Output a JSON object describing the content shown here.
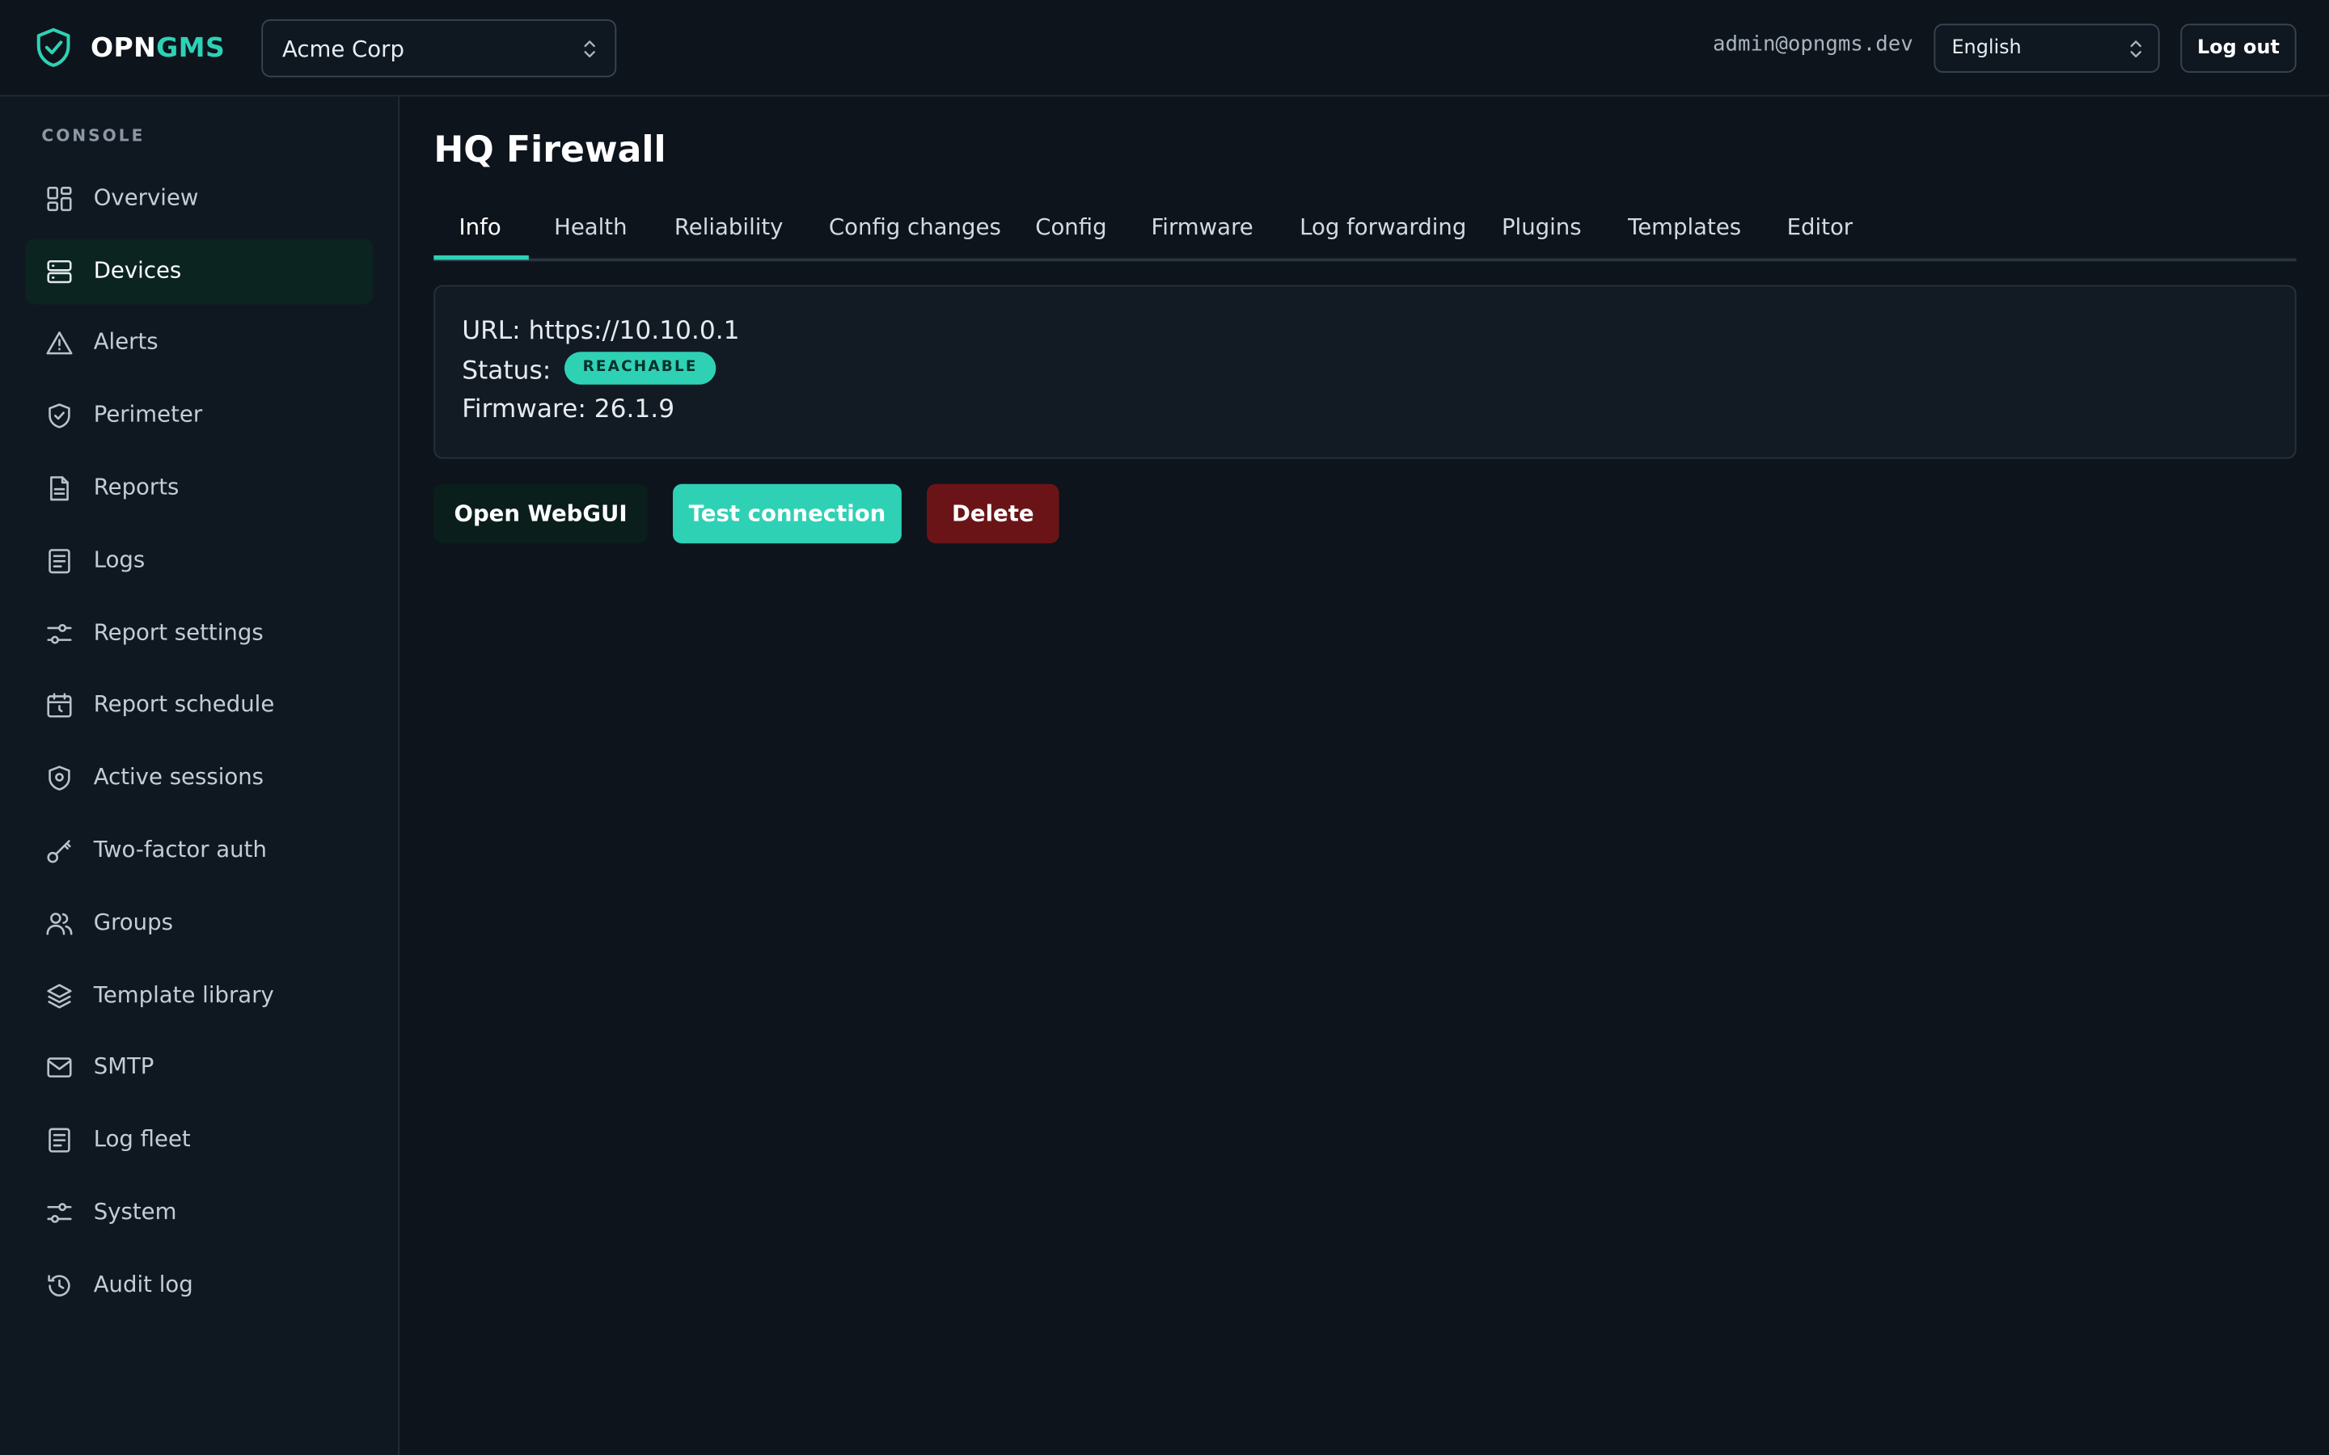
{
  "brand": {
    "part1": "OPN",
    "part2": "GMS",
    "accent": "#2fd1b5"
  },
  "org_select": {
    "value": "Acme Corp"
  },
  "header": {
    "user_email": "admin@opngms.dev",
    "language": "English",
    "logout_label": "Log out"
  },
  "sidebar": {
    "section_label": "CONSOLE",
    "items": [
      {
        "label": "Overview",
        "icon": "grid-icon"
      },
      {
        "label": "Devices",
        "icon": "server-icon",
        "active": true
      },
      {
        "label": "Alerts",
        "icon": "alert-triangle-icon"
      },
      {
        "label": "Perimeter",
        "icon": "shield-check-icon"
      },
      {
        "label": "Reports",
        "icon": "file-icon"
      },
      {
        "label": "Logs",
        "icon": "list-doc-icon"
      },
      {
        "label": "Report settings",
        "icon": "sliders-icon"
      },
      {
        "label": "Report schedule",
        "icon": "calendar-icon"
      },
      {
        "label": "Active sessions",
        "icon": "map-pin-shield-icon"
      },
      {
        "label": "Two-factor auth",
        "icon": "key-icon"
      },
      {
        "label": "Groups",
        "icon": "users-icon"
      },
      {
        "label": "Template library",
        "icon": "layers-icon"
      },
      {
        "label": "SMTP",
        "icon": "mail-icon"
      },
      {
        "label": "Log fleet",
        "icon": "list-doc-icon"
      },
      {
        "label": "System",
        "icon": "sliders-icon"
      },
      {
        "label": "Audit log",
        "icon": "history-icon"
      }
    ]
  },
  "page": {
    "title": "HQ Firewall",
    "tabs": [
      "Info",
      "Health",
      "Reliability",
      "Config changes",
      "Config",
      "Firmware",
      "Log forwarding",
      "Plugins",
      "Templates",
      "Editor"
    ],
    "active_tab": "Info"
  },
  "device_info": {
    "url_line": "URL: https://10.10.0.1",
    "status_label": "Status:",
    "status_value": "REACHABLE",
    "firmware_line": "Firmware: 26.1.9"
  },
  "actions": {
    "open_webgui": "Open WebGUI",
    "test_connection": "Test connection",
    "delete": "Delete"
  },
  "colors": {
    "background": "#0d141c",
    "accent": "#2fd1b5",
    "danger": "#6b1417"
  }
}
